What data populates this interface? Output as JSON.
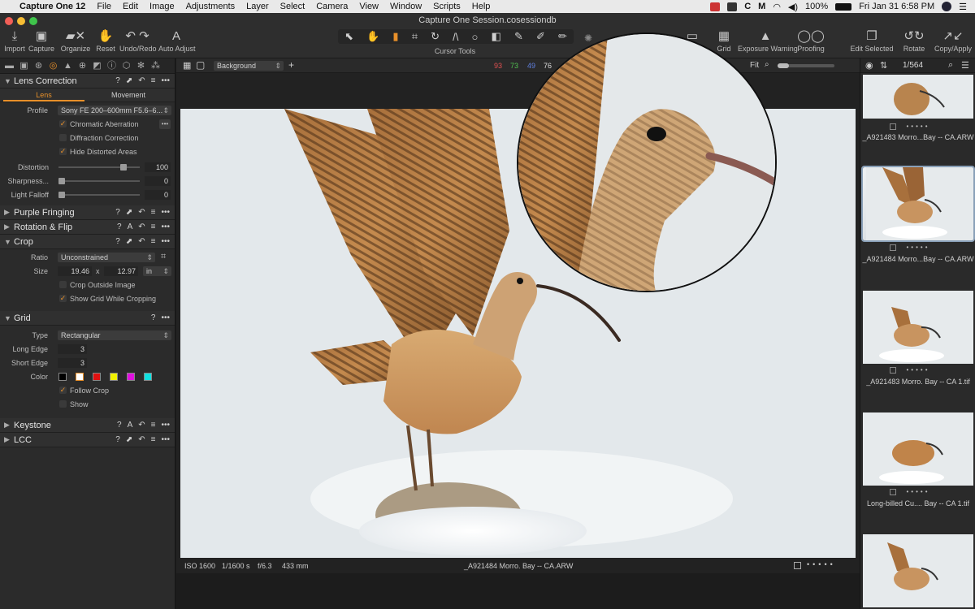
{
  "menubar": {
    "app_name": "Capture One 12",
    "items": [
      "File",
      "Edit",
      "Image",
      "Adjustments",
      "Layer",
      "Select",
      "Camera",
      "View",
      "Window",
      "Scripts",
      "Help"
    ],
    "battery": "100%",
    "clock": "Fri Jan 31  6:58 PM"
  },
  "window": {
    "title": "Capture One Session.cosessiondb"
  },
  "toolbar": {
    "import": "Import",
    "capture": "Capture",
    "organize": "Organize",
    "reset": "Reset",
    "undo_redo": "Undo/Redo",
    "auto_adjust": "Auto Adjust",
    "cursor_tools": "Cursor Tools",
    "grid": "Grid",
    "exposure_warning": "Exposure Warning",
    "proofing": "Proofing",
    "edit_selected": "Edit Selected",
    "rotate": "Rotate",
    "copy_apply": "Copy/Apply"
  },
  "viewer": {
    "layer": "Background",
    "rgb": {
      "r": "93",
      "g": "73",
      "b": "49",
      "l": "76"
    },
    "fit": "Fit",
    "counter": "1/564",
    "status": {
      "iso": "ISO 1600",
      "shutter": "1/1600 s",
      "aperture": "f/6.3",
      "focal": "433 mm",
      "filename": "_A921484 Morro. Bay -- CA.ARW"
    }
  },
  "lens": {
    "title": "Lens Correction",
    "tab_lens": "Lens",
    "tab_movement": "Movement",
    "profile_label": "Profile",
    "profile_value": "Sony FE 200–600mm F5.6–6...",
    "chromatic": "Chromatic Aberration",
    "diffraction": "Diffraction Correction",
    "hide_distorted": "Hide Distorted Areas",
    "distortion_label": "Distortion",
    "distortion_value": "100",
    "sharpness_label": "Sharpness...",
    "sharpness_value": "0",
    "falloff_label": "Light Falloff",
    "falloff_value": "0"
  },
  "sections": {
    "purple": "Purple Fringing",
    "rotation": "Rotation & Flip",
    "crop": "Crop",
    "grid": "Grid",
    "keystone": "Keystone",
    "lcc": "LCC"
  },
  "crop": {
    "ratio_label": "Ratio",
    "ratio_value": "Unconstrained",
    "size_label": "Size",
    "width": "19.46",
    "x": "x",
    "height": "12.97",
    "unit": "in",
    "outside_image": "Crop Outside Image",
    "show_grid": "Show Grid While Cropping"
  },
  "grid": {
    "type_label": "Type",
    "type_value": "Rectangular",
    "long_label": "Long Edge",
    "long_value": "3",
    "short_label": "Short Edge",
    "short_value": "3",
    "color_label": "Color",
    "colors": [
      "#000000",
      "#ffffff",
      "#e01010",
      "#f0f000",
      "#e010e0",
      "#10e0e0"
    ],
    "follow_crop": "Follow Crop",
    "show": "Show"
  },
  "thumbnails": [
    {
      "caption": "_A921483 Morro...Bay -- CA.ARW"
    },
    {
      "caption": "_A921484 Morro...Bay -- CA.ARW"
    },
    {
      "caption": "_A921483 Morro. Bay -- CA 1.tif"
    },
    {
      "caption": "Long-billed Cu.... Bay -- CA 1.tif"
    }
  ],
  "colors": {
    "accent": "#e8902a",
    "red": "#e05050",
    "green": "#50c050",
    "blue": "#6080e0"
  }
}
